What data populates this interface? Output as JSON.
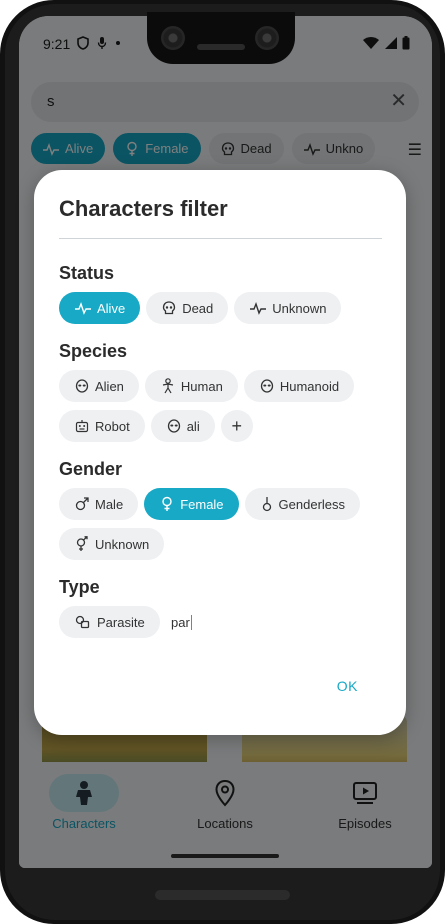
{
  "status_bar": {
    "time": "9:21"
  },
  "search": {
    "value": "s"
  },
  "background_chips": [
    {
      "label": "Alive",
      "icon": "pulse-icon",
      "selected": true
    },
    {
      "label": "Female",
      "icon": "female-icon",
      "selected": true
    },
    {
      "label": "Dead",
      "icon": "skull-icon",
      "selected": false
    },
    {
      "label": "Unkno",
      "icon": "pulse-icon",
      "selected": false
    }
  ],
  "dialog": {
    "title": "Characters filter",
    "status": {
      "title": "Status",
      "chips": [
        {
          "label": "Alive",
          "icon": "pulse-icon",
          "selected": true
        },
        {
          "label": "Dead",
          "icon": "skull-icon",
          "selected": false
        },
        {
          "label": "Unknown",
          "icon": "pulse-icon",
          "selected": false
        }
      ]
    },
    "species": {
      "title": "Species",
      "chips": [
        {
          "label": "Alien",
          "icon": "alien-icon",
          "selected": false
        },
        {
          "label": "Human",
          "icon": "human-icon",
          "selected": false
        },
        {
          "label": "Humanoid",
          "icon": "alien-icon",
          "selected": false
        },
        {
          "label": "Robot",
          "icon": "robot-icon",
          "selected": false
        },
        {
          "label": "ali",
          "icon": "alien-icon",
          "selected": false
        }
      ],
      "add_label": "+"
    },
    "gender": {
      "title": "Gender",
      "chips": [
        {
          "label": "Male",
          "icon": "male-icon",
          "selected": false
        },
        {
          "label": "Female",
          "icon": "female-icon",
          "selected": true
        },
        {
          "label": "Genderless",
          "icon": "genderless-icon",
          "selected": false
        },
        {
          "label": "Unknown",
          "icon": "unknown-gender-icon",
          "selected": false
        }
      ]
    },
    "type": {
      "title": "Type",
      "chips": [
        {
          "label": "Parasite",
          "icon": "parasite-icon",
          "selected": false
        }
      ],
      "input_value": "par"
    },
    "ok_label": "OK"
  },
  "bottom_nav": [
    {
      "label": "Characters",
      "icon": "character-icon",
      "active": true
    },
    {
      "label": "Locations",
      "icon": "location-pin-icon",
      "active": false
    },
    {
      "label": "Episodes",
      "icon": "play-video-icon",
      "active": false
    }
  ],
  "colors": {
    "accent": "#17a9c6",
    "chip_bg": "#eef0f2",
    "scrim": "#000000"
  }
}
